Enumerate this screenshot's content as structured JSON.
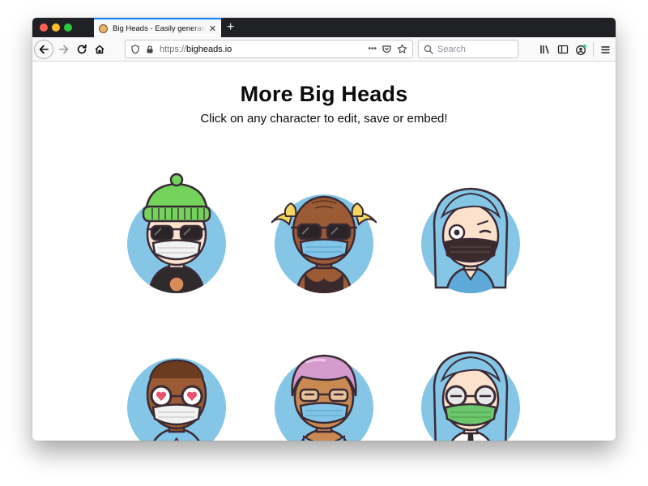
{
  "browser": {
    "tab_title": "Big Heads - Easily generate avatars",
    "tab_close": "✕",
    "new_tab": "+",
    "url_scheme": "https://",
    "url_host": "bigheads.io",
    "search_placeholder": "Search",
    "page_actions": "•••"
  },
  "page": {
    "title": "More Big Heads",
    "subtitle": "Click on any character to edit, save or embed!"
  },
  "avatars": [
    {
      "name": "green-beanie-sunglasses-mask",
      "hair": "#73d35a",
      "skin": "#fce2cd",
      "mask": "#f2f2f2",
      "shirt": "#2f2a2b"
    },
    {
      "name": "bald-sunglasses-blue-mask",
      "hair": "#f5d65e",
      "skin": "#9b5b34",
      "mask": "#83c5e8",
      "shirt": "#83c5e8"
    },
    {
      "name": "blue-hair-wink-black-mask",
      "hair": "#85c6e6",
      "skin": "#fce2cd",
      "mask": "#3b2a2c",
      "shirt": "#85c6e6"
    },
    {
      "name": "heart-eyes-white-mask",
      "hair": "#6b3c1f",
      "skin": "#9b5b34",
      "mask": "#f2f2f2",
      "shirt": "#83c5e8"
    },
    {
      "name": "pink-hair-blue-mask",
      "hair": "#d59bcc",
      "skin": "#c98952",
      "mask": "#83c5e8",
      "shirt": "#83c5e8"
    },
    {
      "name": "blue-hair-round-glasses-green-mask",
      "hair": "#85c6e6",
      "skin": "#fce2cd",
      "mask": "#6cc66c",
      "shirt": "#ffffff"
    }
  ],
  "colors": {
    "circle_bg": "#85c6e6",
    "outline": "#3a2a35",
    "accent": "#0a84ff"
  }
}
